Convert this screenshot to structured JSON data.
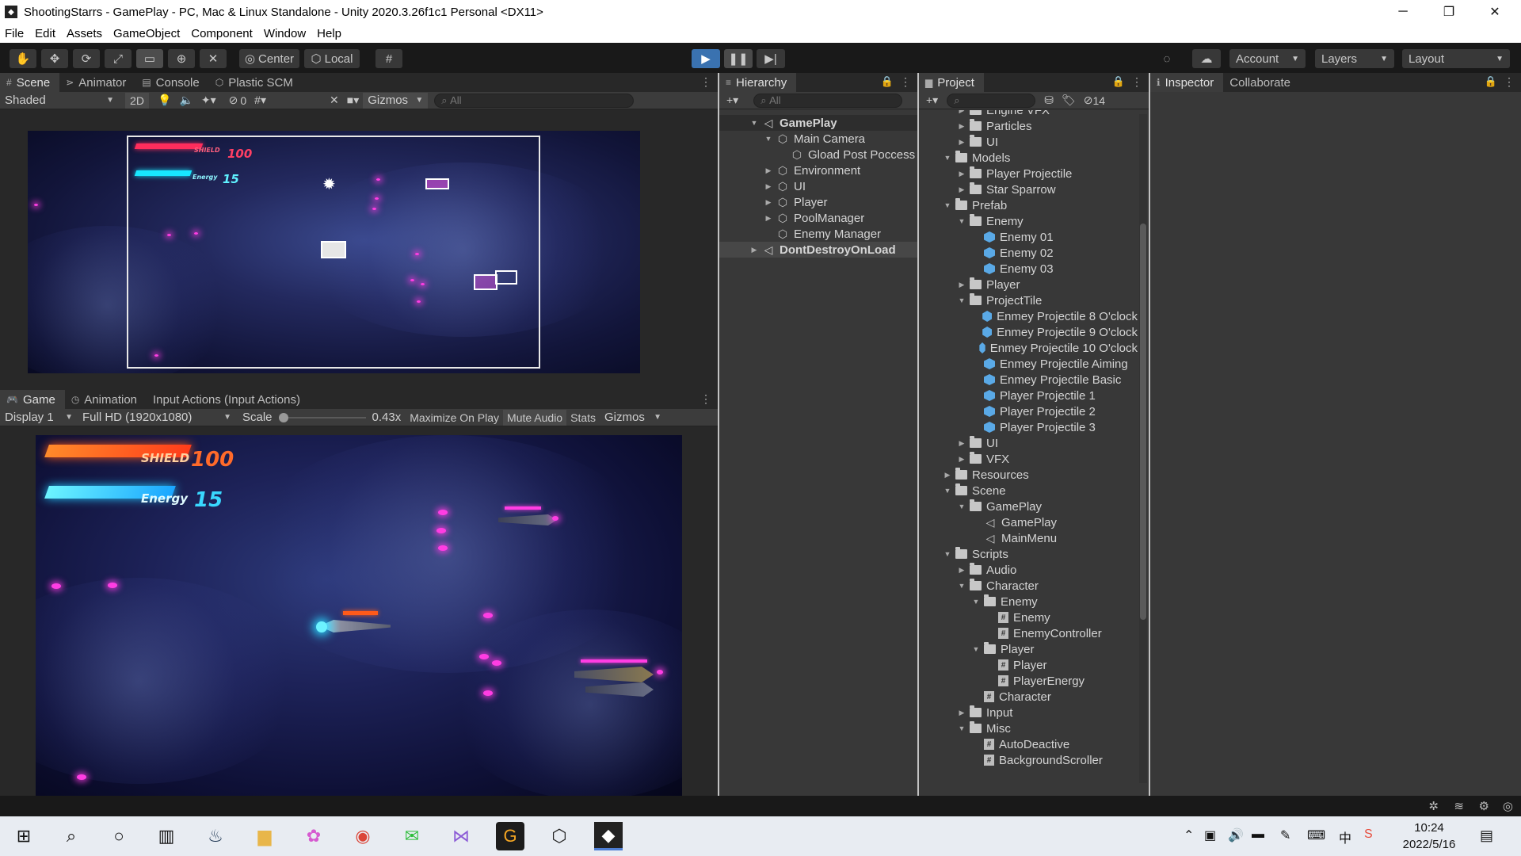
{
  "window": {
    "title": "ShootingStarrs - GamePlay - PC, Mac & Linux Standalone - Unity 2020.3.26f1c1 Personal <DX11>",
    "minimize": "─",
    "restore": "❐",
    "close": "✕"
  },
  "menu": [
    "File",
    "Edit",
    "Assets",
    "GameObject",
    "Component",
    "Window",
    "Help"
  ],
  "toolbar": {
    "pivot": "Center",
    "space": "Local",
    "account": "Account",
    "layers": "Layers",
    "layout": "Layout"
  },
  "scene_panel": {
    "tabs": [
      "Scene",
      "Animator",
      "Console",
      "Plastic SCM"
    ],
    "shading": "Shaded",
    "mode_2d": "2D",
    "hidden_count": "0",
    "gizmos": "Gizmos",
    "search_placeholder": "All",
    "hud": {
      "shield_label": "SHIELD",
      "shield_value": "100",
      "energy_label": "Energy",
      "energy_value": "15"
    }
  },
  "game_panel": {
    "tabs": [
      "Game",
      "Animation",
      "Input Actions (Input Actions)"
    ],
    "display": "Display 1",
    "resolution": "Full HD (1920x1080)",
    "scale_label": "Scale",
    "scale_value": "0.43x",
    "maximize": "Maximize On Play",
    "mute": "Mute Audio",
    "stats": "Stats",
    "gizmos": "Gizmos",
    "hud": {
      "shield_label": "SHIELD",
      "shield_value": "100",
      "energy_label": "Energy",
      "energy_value": "15"
    }
  },
  "hierarchy": {
    "tab": "Hierarchy",
    "search_placeholder": "All",
    "items": [
      {
        "label": "GamePlay",
        "depth": 0,
        "expand": "open",
        "icon": "unity-scene-icon"
      },
      {
        "label": "Main Camera",
        "depth": 1,
        "expand": "open",
        "icon": "gameobject-icon"
      },
      {
        "label": "Gload Post Poccess",
        "depth": 2,
        "expand": "none",
        "icon": "gameobject-icon"
      },
      {
        "label": "Environment",
        "depth": 1,
        "expand": "closed",
        "icon": "gameobject-icon"
      },
      {
        "label": "UI",
        "depth": 1,
        "expand": "closed",
        "icon": "gameobject-icon"
      },
      {
        "label": "Player",
        "depth": 1,
        "expand": "closed",
        "icon": "gameobject-icon"
      },
      {
        "label": "PoolManager",
        "depth": 1,
        "expand": "closed",
        "icon": "gameobject-icon"
      },
      {
        "label": "Enemy Manager",
        "depth": 1,
        "expand": "none",
        "icon": "gameobject-icon"
      },
      {
        "label": "DontDestroyOnLoad",
        "depth": 0,
        "expand": "closed",
        "icon": "unity-scene-icon"
      }
    ]
  },
  "project": {
    "tab": "Project",
    "hidden_count": "14",
    "items": [
      {
        "label": "Engine VFX",
        "depth": 1,
        "expand": "closed",
        "type": "folder"
      },
      {
        "label": "Particles",
        "depth": 1,
        "expand": "closed",
        "type": "folder"
      },
      {
        "label": "UI",
        "depth": 1,
        "expand": "closed",
        "type": "folder"
      },
      {
        "label": "Models",
        "depth": 0,
        "expand": "open",
        "type": "folder"
      },
      {
        "label": "Player Projectile",
        "depth": 1,
        "expand": "closed",
        "type": "folder"
      },
      {
        "label": "Star Sparrow",
        "depth": 1,
        "expand": "closed",
        "type": "folder"
      },
      {
        "label": "Prefab",
        "depth": 0,
        "expand": "open",
        "type": "folder"
      },
      {
        "label": "Enemy",
        "depth": 1,
        "expand": "open",
        "type": "folder"
      },
      {
        "label": "Enemy 01",
        "depth": 2,
        "expand": "none",
        "type": "prefab"
      },
      {
        "label": "Enemy 02",
        "depth": 2,
        "expand": "none",
        "type": "prefab"
      },
      {
        "label": "Enemy 03",
        "depth": 2,
        "expand": "none",
        "type": "prefab"
      },
      {
        "label": "Player",
        "depth": 1,
        "expand": "closed",
        "type": "folder"
      },
      {
        "label": "ProjectTile",
        "depth": 1,
        "expand": "open",
        "type": "folder"
      },
      {
        "label": "Enmey Projectile 8 O'clock",
        "depth": 2,
        "expand": "none",
        "type": "prefab"
      },
      {
        "label": "Enmey Projectile 9 O'clock",
        "depth": 2,
        "expand": "none",
        "type": "prefab"
      },
      {
        "label": "Enmey Projectile 10 O'clock",
        "depth": 2,
        "expand": "none",
        "type": "prefab"
      },
      {
        "label": "Enmey Projectile Aiming",
        "depth": 2,
        "expand": "none",
        "type": "prefab"
      },
      {
        "label": "Enmey Projectile Basic",
        "depth": 2,
        "expand": "none",
        "type": "prefab"
      },
      {
        "label": "Player Projectile 1",
        "depth": 2,
        "expand": "none",
        "type": "prefab"
      },
      {
        "label": "Player Projectile 2",
        "depth": 2,
        "expand": "none",
        "type": "prefab"
      },
      {
        "label": "Player Projectile 3",
        "depth": 2,
        "expand": "none",
        "type": "prefab"
      },
      {
        "label": "UI",
        "depth": 1,
        "expand": "closed",
        "type": "folder"
      },
      {
        "label": "VFX",
        "depth": 1,
        "expand": "closed",
        "type": "folder"
      },
      {
        "label": "Resources",
        "depth": 0,
        "expand": "closed",
        "type": "folder"
      },
      {
        "label": "Scene",
        "depth": 0,
        "expand": "open",
        "type": "folder"
      },
      {
        "label": "GamePlay",
        "depth": 1,
        "expand": "open",
        "type": "folder"
      },
      {
        "label": "GamePlay",
        "depth": 2,
        "expand": "none",
        "type": "scene"
      },
      {
        "label": "MainMenu",
        "depth": 2,
        "expand": "none",
        "type": "scene"
      },
      {
        "label": "Scripts",
        "depth": 0,
        "expand": "open",
        "type": "folder"
      },
      {
        "label": "Audio",
        "depth": 1,
        "expand": "closed",
        "type": "folder"
      },
      {
        "label": "Character",
        "depth": 1,
        "expand": "open",
        "type": "folder"
      },
      {
        "label": "Enemy",
        "depth": 2,
        "expand": "open",
        "type": "folder"
      },
      {
        "label": "Enemy",
        "depth": 3,
        "expand": "none",
        "type": "script"
      },
      {
        "label": "EnemyController",
        "depth": 3,
        "expand": "none",
        "type": "script"
      },
      {
        "label": "Player",
        "depth": 2,
        "expand": "open",
        "type": "folder"
      },
      {
        "label": "Player",
        "depth": 3,
        "expand": "none",
        "type": "script"
      },
      {
        "label": "PlayerEnergy",
        "depth": 3,
        "expand": "none",
        "type": "script"
      },
      {
        "label": "Character",
        "depth": 2,
        "expand": "none",
        "type": "script"
      },
      {
        "label": "Input",
        "depth": 1,
        "expand": "closed",
        "type": "folder"
      },
      {
        "label": "Misc",
        "depth": 1,
        "expand": "open",
        "type": "folder"
      },
      {
        "label": "AutoDeactive",
        "depth": 2,
        "expand": "none",
        "type": "script"
      },
      {
        "label": "BackgroundScroller",
        "depth": 2,
        "expand": "none",
        "type": "script"
      }
    ]
  },
  "inspector": {
    "tabs": [
      "Inspector",
      "Collaborate"
    ]
  },
  "taskbar": {
    "time": "10:24",
    "date": "2022/5/16"
  }
}
